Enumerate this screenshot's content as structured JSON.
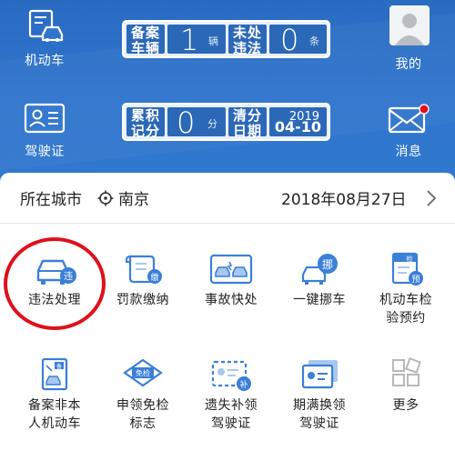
{
  "colors": {
    "header_blue": "#2f75cd",
    "icon_blue": "#3b7fd8",
    "alert_red": "#e0101b"
  },
  "header": {
    "vehicle_label": "机动车",
    "license_label": "驾驶证",
    "mine_label": "我的",
    "message_label": "消息",
    "registered_tag_line1": "备案",
    "registered_tag_line2": "车辆",
    "registered_count": "1",
    "registered_unit": "辆",
    "violation_tag_line1": "未处",
    "violation_tag_line2": "违法",
    "violation_count": "0",
    "violation_unit": "条",
    "points_tag_line1": "累积",
    "points_tag_line2": "记分",
    "points_count": "0",
    "points_unit": "分",
    "clear_tag_line1": "清分",
    "clear_tag_line2": "日期",
    "clear_year": "2019",
    "clear_date": "04-10"
  },
  "city_row": {
    "label": "所在城市",
    "city": "南京",
    "date": "2018年08月27日"
  },
  "services": [
    {
      "label": "违法处理",
      "icon": "car-violation-icon",
      "badge": "违"
    },
    {
      "label": "罚款缴纳",
      "icon": "fine-scroll-icon",
      "badge": "缴"
    },
    {
      "label": "事故快处",
      "icon": "accident-icon"
    },
    {
      "label": "一键挪车",
      "icon": "move-car-icon",
      "badge": "挪"
    },
    {
      "label_line1": "机动车检",
      "label_line2": "验预约",
      "icon": "inspection-icon",
      "badge": "预",
      "tag": "检"
    },
    {
      "label_line1": "备案非本",
      "label_line2": "人机动车",
      "icon": "record-car-icon",
      "tag": "备"
    },
    {
      "label_line1": "申领免检",
      "label_line2": "标志",
      "icon": "exempt-tag-icon",
      "tag": "免检"
    },
    {
      "label_line1": "遗失补领",
      "label_line2": "驾驶证",
      "icon": "lost-license-icon",
      "badge": "补"
    },
    {
      "label_line1": "期满换领",
      "label_line2": "驾驶证",
      "icon": "renew-license-icon"
    },
    {
      "label": "更多",
      "icon": "more-grid-icon"
    }
  ]
}
